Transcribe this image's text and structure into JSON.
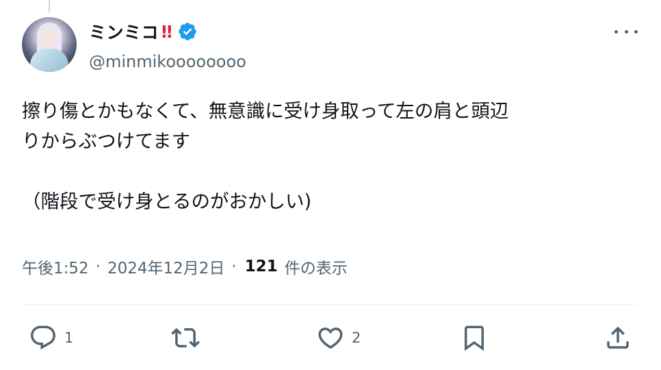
{
  "tweet": {
    "author": {
      "display_name": "ミンミコ",
      "emphasis": "‼",
      "handle": "@minmikoooooooo",
      "verified_icon": "verified-badge-icon",
      "avatar_icon": "avatar"
    },
    "text": "擦り傷とかもなくて、無意識に受け身取って左の肩と頭辺\nりからぶつけてます\n\n（階段で受け身とるのがおかしい)",
    "meta": {
      "time": "午後1:52",
      "separator": "·",
      "date": "2024年12月2日",
      "views_count": "121",
      "views_label": "件の表示"
    },
    "actions": {
      "reply_count": "1",
      "retweet_count": "",
      "like_count": "2",
      "icons": [
        "reply-icon",
        "retweet-icon",
        "like-icon",
        "bookmark-icon",
        "share-icon"
      ]
    },
    "colors": {
      "verified": "#1d9bf0",
      "secondary_text": "#536471",
      "emphasis": "#e0243e"
    }
  }
}
